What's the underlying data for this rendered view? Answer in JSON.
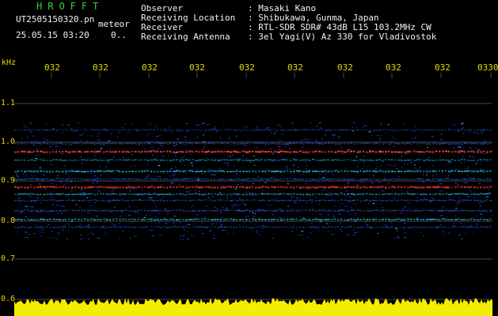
{
  "header": {
    "logo": "HROFFT",
    "file_name": "UT2505150320.pn",
    "file_type": "meteor",
    "date_time": "25.05.15 03:20",
    "count": "0.."
  },
  "info": [
    {
      "label": "Observer",
      "value": ": Masaki Kano"
    },
    {
      "label": "Receiving Location",
      "value": ": Shibukawa, Gunma, Japan"
    },
    {
      "label": "Receiver",
      "value": ": RTL-SDR SDR# 43dB L15 103.2MHz CW"
    },
    {
      "label": "Receiving Antenna",
      "value": ": 3el Yagi(V) Az 330 for Vladivostok"
    }
  ],
  "axis": {
    "unit": "kHz",
    "time_ticks": [
      "032",
      "032",
      "032",
      "032",
      "032",
      "032",
      "032",
      "032",
      "032",
      "0330"
    ],
    "freq_ticks": [
      "1.1",
      "1.0",
      "0.9",
      "0.8",
      "0.7",
      "0.6"
    ]
  },
  "colors": {
    "text_green": "#35d335",
    "text_white": "#f2f2f2",
    "axis_yellow": "#e5d900",
    "signal_red": "#ff3b3b",
    "noise_blue": "#1e4cff",
    "noise_cyan": "#26d7ff"
  }
}
